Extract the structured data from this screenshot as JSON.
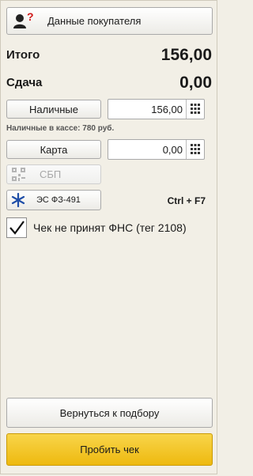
{
  "buyer_button": {
    "label": "Данные покупателя",
    "badge": "?"
  },
  "totals": {
    "total_label": "Итого",
    "total_value": "156,00",
    "change_label": "Сдача",
    "change_value": "0,00"
  },
  "cash": {
    "button_label": "Наличные",
    "input_value": "156,00",
    "note": "Наличные в кассе: 780 руб."
  },
  "card": {
    "button_label": "Карта",
    "input_value": "0,00"
  },
  "sbp": {
    "label": "СБП"
  },
  "es": {
    "label": "ЭС ФЗ-491",
    "shortcut": "Ctrl + F7"
  },
  "fns_checkbox": {
    "label": "Чек не принят ФНС (тег 2108)",
    "checked": true
  },
  "footer": {
    "back_label": "Вернуться к подбору",
    "print_label": "Пробить чек"
  },
  "colors": {
    "background": "#f2efe6",
    "primary_button": "#f3c31e",
    "es_icon": "#1f4ea8"
  }
}
